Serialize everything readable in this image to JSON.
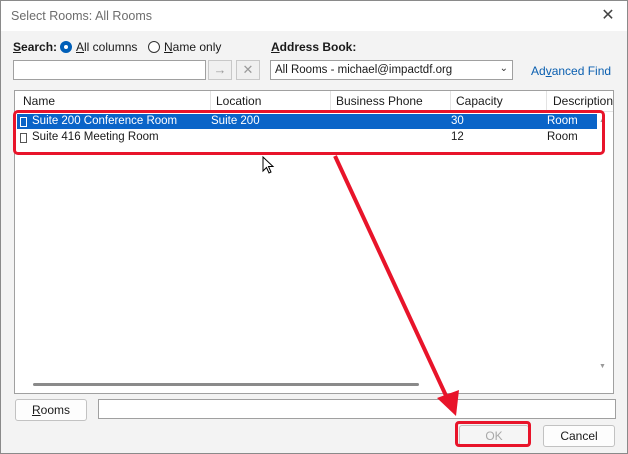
{
  "dialog": {
    "title": "Select Rooms: All Rooms"
  },
  "search": {
    "label_key": "S",
    "label_rest": "earch:",
    "all_columns_key": "A",
    "all_columns_rest": "ll columns",
    "name_only_key": "N",
    "name_only_rest": "ame only",
    "value": "",
    "selected": "All columns"
  },
  "address_book": {
    "label_key": "A",
    "label_rest": "ddress Book:",
    "selected": "All Rooms - michael@impactdf.org",
    "advanced_pre": "Ad",
    "advanced_key": "v",
    "advanced_rest": "anced Find"
  },
  "table": {
    "columns": [
      "Name",
      "Location",
      "Business Phone",
      "Capacity",
      "Description"
    ],
    "rows": [
      {
        "name": "Suite 200 Conference Room",
        "location": "Suite 200",
        "phone": "",
        "capacity": "30",
        "description": "Room",
        "selected": true
      },
      {
        "name": "Suite 416 Meeting Room",
        "location": "",
        "phone": "",
        "capacity": "12",
        "description": "Room",
        "selected": false
      }
    ]
  },
  "footer": {
    "rooms_key": "R",
    "rooms_rest": "ooms",
    "rooms_value": "",
    "ok_label": "OK",
    "cancel_label": "Cancel"
  },
  "colors": {
    "selection": "#0a64c8",
    "annotation": "#e8142a",
    "link": "#0a5fb0"
  }
}
